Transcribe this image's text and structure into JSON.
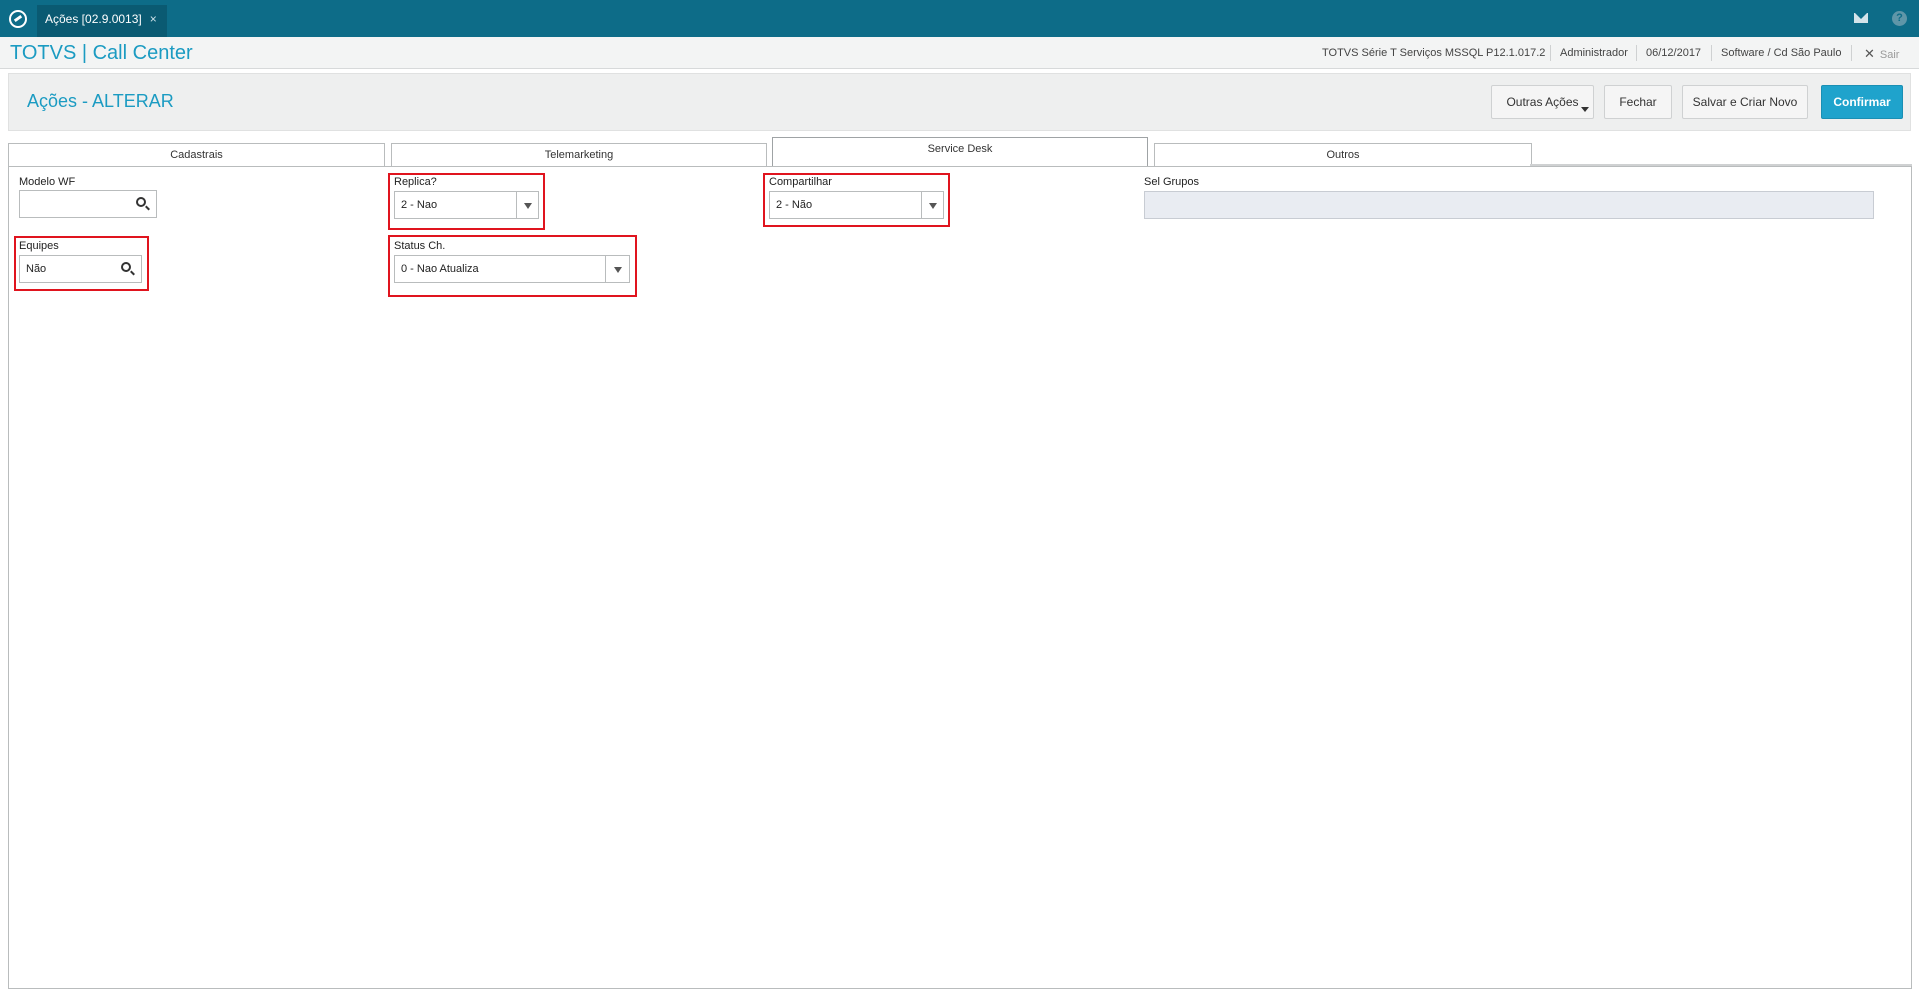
{
  "window": {
    "tab_label": "Ações [02.9.0013]",
    "tab_close": "×",
    "help": "?"
  },
  "header": {
    "app_title": "TOTVS | Call Center",
    "environment": "TOTVS Série T Serviços MSSQL P12.1.017.2",
    "user": "Administrador",
    "date": "06/12/2017",
    "branch": "Software / Cd São Paulo",
    "exit_label": "Sair",
    "exit_x": "✕"
  },
  "page": {
    "title": "Ações - ALTERAR",
    "buttons": {
      "other_actions": "Outras Ações",
      "close": "Fechar",
      "save_new": "Salvar e Criar Novo",
      "confirm": "Confirmar"
    }
  },
  "tabs": [
    {
      "label": "Cadastrais"
    },
    {
      "label": "Telemarketing"
    },
    {
      "label": "Service Desk"
    },
    {
      "label": "Outros"
    }
  ],
  "form": {
    "modelo_wf": {
      "label": "Modelo WF",
      "value": ""
    },
    "replica": {
      "label": "Replica?",
      "value": "2 - Nao"
    },
    "compartilhar": {
      "label": "Compartilhar",
      "value": "2 - Não"
    },
    "sel_grupos": {
      "label": "Sel Grupos",
      "value": ""
    },
    "equipes": {
      "label": "Equipes",
      "value": "Não"
    },
    "status_ch": {
      "label": "Status Ch.",
      "value": "0 - Nao Atualiza"
    }
  },
  "colors": {
    "topbar": "#0d6c88",
    "accent": "#1fa3cc",
    "highlight": "#e0141e"
  }
}
